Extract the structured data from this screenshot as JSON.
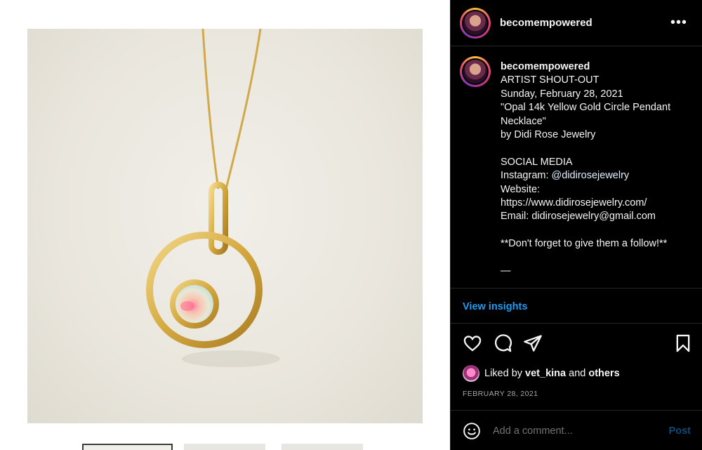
{
  "post": {
    "username": "becomempowered",
    "more_icon": "more-horizontal-icon"
  },
  "caption": {
    "username": "becomempowered",
    "lines_before_mention": "ARTIST SHOUT-OUT\nSunday, February 28, 2021\n\"Opal 14k Yellow Gold Circle Pendant Necklace\"\nby Didi Rose Jewelry\n\nSOCIAL MEDIA\nInstagram: ",
    "mention": "@didirosejewelry",
    "lines_after_mention": "\nWebsite:\nhttps://www.didirosejewelry.com/\nEmail: didirosejewelry@gmail.com\n\n**Don't forget to give them a follow!**\n\n—"
  },
  "insights": {
    "label": "View insights"
  },
  "actions": {
    "icons": [
      "heart-icon",
      "comment-icon",
      "share-icon",
      "bookmark-icon"
    ]
  },
  "likes": {
    "prefix": "Liked by ",
    "user": "vet_kina",
    "middle": " and ",
    "others": "others"
  },
  "date": "FEBRUARY 28, 2021",
  "comment": {
    "placeholder": "Add a comment...",
    "post_label": "Post"
  },
  "colors": {
    "link": "#1f9bf0",
    "panel_bg": "#000000",
    "post_disabled": "#0d4a7a"
  }
}
